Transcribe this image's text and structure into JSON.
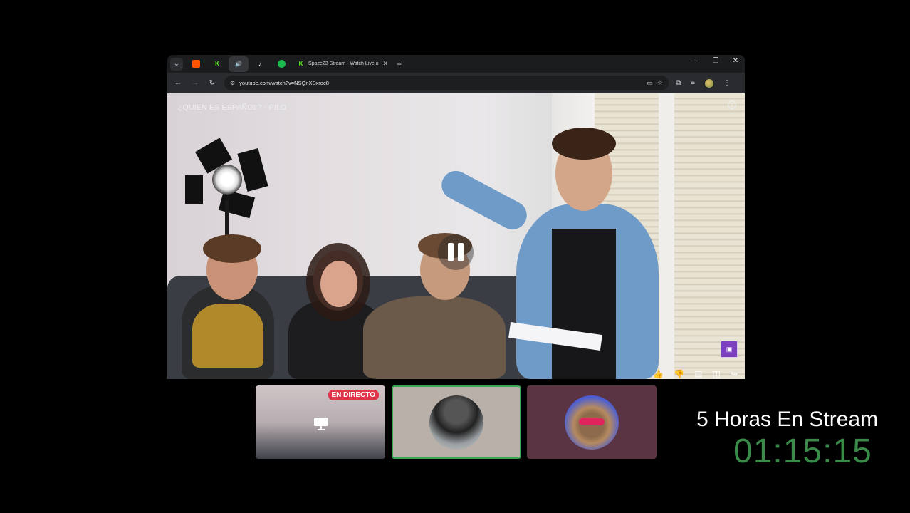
{
  "browser": {
    "tab_title": "Spaze23 Stream - Watch Live o",
    "url": "youtube.com/watch?v=NSQnXSxroc8",
    "new_tab_symbol": "+",
    "window_controls": {
      "minimize": "–",
      "restore": "❐",
      "close": "✕"
    }
  },
  "video": {
    "title": "¿QUIEN ES ESPAÑOL? · PILO",
    "state": "paused",
    "badge_label": "",
    "actions": [
      "like-icon",
      "dislike-icon",
      "comment-icon",
      "save-icon",
      "share-icon"
    ]
  },
  "tiles": [
    {
      "label": "EN DIRECTO",
      "type": "live-video"
    },
    {
      "label": "",
      "type": "avatar"
    },
    {
      "label": "",
      "type": "avatar"
    }
  ],
  "timer": {
    "label": "5 Horas En Stream",
    "value": "01:15:15",
    "color": "#3a8a4a"
  },
  "colors": {
    "live_badge": "#e0344a",
    "selected_tile_border": "#3aa655",
    "tile_3_bg": "#5b3444"
  }
}
